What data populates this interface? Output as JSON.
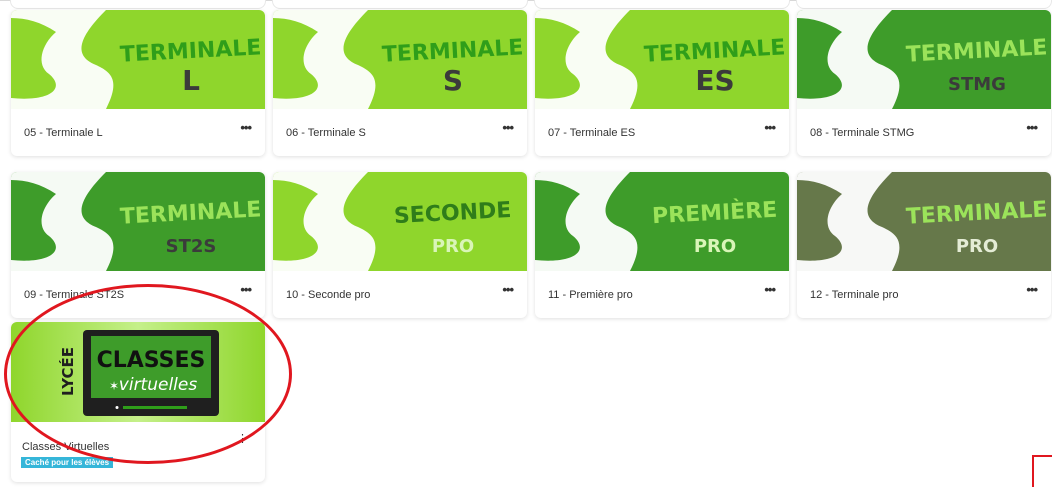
{
  "cards": [
    {
      "title": "05 - Terminale L",
      "banner_word": "TERMINALE",
      "banner_sub": "L",
      "menu": "•••",
      "bg": "#8fd62c",
      "swoosh": "#ffffff",
      "text": "#2f9e1a",
      "sub": "#3b3b3b"
    },
    {
      "title": "06 - Terminale S",
      "banner_word": "TERMINALE",
      "banner_sub": "S",
      "menu": "•••",
      "bg": "#8fd62c",
      "swoosh": "#ffffff",
      "text": "#2f9e1a",
      "sub": "#3b3b3b"
    },
    {
      "title": "07 - Terminale ES",
      "banner_word": "TERMINALE",
      "banner_sub": "ES",
      "menu": "•••",
      "bg": "#8fd62c",
      "swoosh": "#ffffff",
      "text": "#2f9e1a",
      "sub": "#3b3b3b"
    },
    {
      "title": "08 - Terminale STMG",
      "banner_word": "TERMINALE",
      "banner_sub": "STMG",
      "menu": "•••",
      "bg": "#3e9c2a",
      "swoosh": "#ffffff",
      "text": "#9be35a",
      "sub": "#3b3b3b"
    },
    {
      "title": "09 - Terminale ST2S",
      "banner_word": "TERMINALE",
      "banner_sub": "ST2S",
      "menu": "•••",
      "bg": "#3e9c2a",
      "swoosh": "#ffffff",
      "text": "#9be35a",
      "sub": "#3b3b3b"
    },
    {
      "title": "10 - Seconde pro",
      "banner_word": "SECONDE",
      "banner_sub": "PRO",
      "menu": "•••",
      "bg": "#8fd62c",
      "swoosh": "#ffffff",
      "text": "#2f7d1a",
      "sub": "#d9f5b8"
    },
    {
      "title": "11 - Première pro",
      "banner_word": "PREMIÈRE",
      "banner_sub": "PRO",
      "menu": "•••",
      "bg": "#3e9c2a",
      "swoosh": "#ffffff",
      "text": "#9be35a",
      "sub": "#d9f5b8"
    },
    {
      "title": "12 - Terminale pro",
      "banner_word": "TERMINALE",
      "banner_sub": "PRO",
      "menu": "•••",
      "bg": "#66784a",
      "swoosh": "#ffffff",
      "text": "#9be35a",
      "sub": "#e4ecd6"
    }
  ],
  "classes_virtuelles": {
    "title": "Classes Virtuelles",
    "badge": "Caché pour les élèves",
    "menu": "⋮",
    "logo_side": "LYCÉE",
    "logo_top": "CLASSES",
    "logo_bottom": "virtuelles",
    "colors": {
      "bg_light": "#c5f08a",
      "bg_mid": "#8fd62c",
      "screen": "#3e9c2a",
      "frame": "#1f1f1f"
    }
  },
  "annotation_color": "#e0171f"
}
